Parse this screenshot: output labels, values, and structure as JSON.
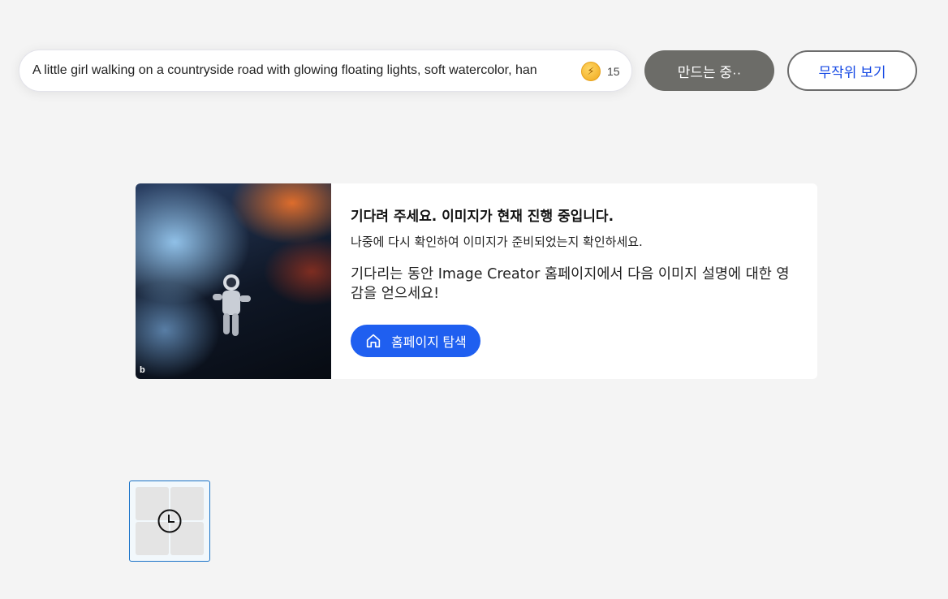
{
  "search": {
    "value": "A little girl walking on a countryside road with glowing floating lights, soft watercolor, han",
    "boost_icon": "lightning-bolt-coin-icon",
    "boost_count": "15"
  },
  "buttons": {
    "create_label": "만드는 중··",
    "surprise_label": "무작위 보기"
  },
  "card": {
    "image_description_icon": "astronaut-in-nebula",
    "watermark": "b",
    "title": "기다려 주세요. 이미지가 현재 진행 중입니다.",
    "subtitle": "나중에 다시 확인하여 이미지가 준비되었는지 확인하세요.",
    "description": "기다리는 동안 Image Creator 홈페이지에서 다음 이미지 설명에 대한 영감을 얻으세요!",
    "explore_label": "홈페이지 탐색",
    "explore_icon": "home-icon"
  },
  "history": {
    "status_icon": "clock-icon"
  },
  "colors": {
    "accent_blue": "#1f5ff0",
    "create_button_gray": "#6c6c68",
    "page_background": "#f4f4f4"
  }
}
